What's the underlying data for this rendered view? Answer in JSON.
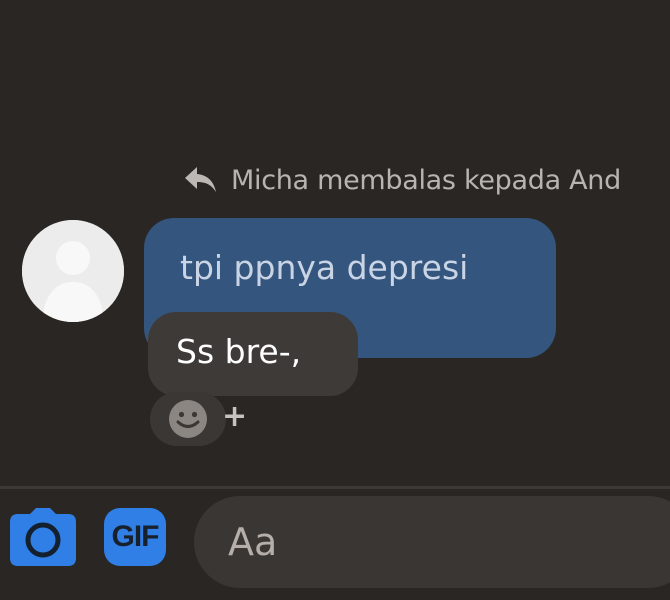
{
  "reply_context": {
    "text": "Micha membalas kepada And",
    "icon": "reply-arrow-icon"
  },
  "messages": {
    "quoted": {
      "text": "tpi ppnya depresi",
      "color": "#34557e"
    },
    "reply": {
      "text": "Ss bre-,",
      "color": "#3e3a38"
    }
  },
  "reaction": {
    "icon": "smiley-icon",
    "add_label": "+"
  },
  "composer": {
    "camera_icon": "camera-icon",
    "gif_label": "GIF",
    "placeholder": "Aa"
  },
  "colors": {
    "background": "#2a2624",
    "accent": "#2f7fe6"
  }
}
